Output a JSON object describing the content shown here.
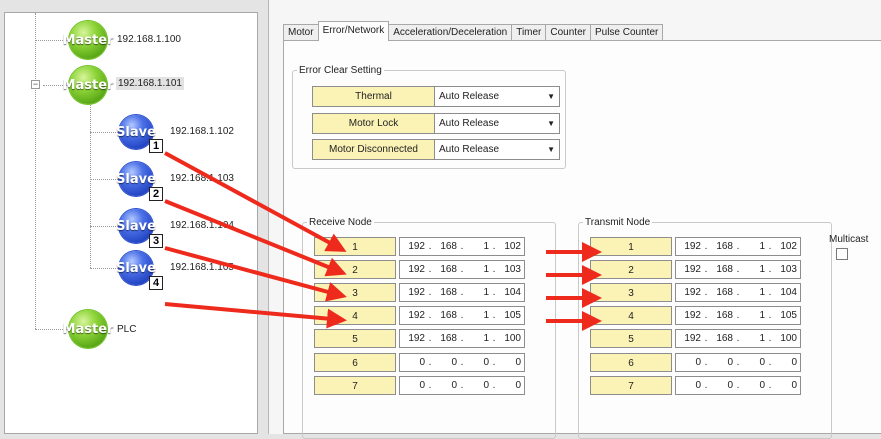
{
  "tree": {
    "masters": [
      {
        "icon_text": "Master",
        "label": "192.168.1.100"
      },
      {
        "icon_text": "Master",
        "label": "192.168.1.101"
      },
      {
        "icon_text": "Master",
        "label": "PLC"
      }
    ],
    "slaves": [
      {
        "icon_text": "Slave",
        "number": "1",
        "label": "192.168.1.102"
      },
      {
        "icon_text": "Slave",
        "number": "2",
        "label": "192.168.1.103"
      },
      {
        "icon_text": "Slave",
        "number": "3",
        "label": "192.168.1.104"
      },
      {
        "icon_text": "Slave",
        "number": "4",
        "label": "192.168.1.105"
      }
    ],
    "expander_symbol": "−"
  },
  "tabs": [
    "Motor",
    "Error/Network",
    "Acceleration/Deceleration",
    "Timer",
    "Counter",
    "Pulse Counter"
  ],
  "active_tab": "Error/Network",
  "error_clear": {
    "legend": "Error Clear Setting",
    "rows": [
      {
        "label": "Thermal",
        "value": "Auto Release"
      },
      {
        "label": "Motor Lock",
        "value": "Auto Release"
      },
      {
        "label": "Motor Disconnected",
        "value": "Auto Release"
      }
    ]
  },
  "receive_node": {
    "legend": "Receive Node",
    "rows": [
      {
        "num": "1",
        "ip": [
          "192",
          "168",
          "1",
          "102"
        ]
      },
      {
        "num": "2",
        "ip": [
          "192",
          "168",
          "1",
          "103"
        ]
      },
      {
        "num": "3",
        "ip": [
          "192",
          "168",
          "1",
          "104"
        ]
      },
      {
        "num": "4",
        "ip": [
          "192",
          "168",
          "1",
          "105"
        ]
      },
      {
        "num": "5",
        "ip": [
          "192",
          "168",
          "1",
          "100"
        ]
      },
      {
        "num": "6",
        "ip": [
          "0",
          "0",
          "0",
          "0"
        ]
      },
      {
        "num": "7",
        "ip": [
          "0",
          "0",
          "0",
          "0"
        ]
      }
    ]
  },
  "transmit_node": {
    "legend": "Transmit Node",
    "multicast_label": "Multicast",
    "multicast_checked": false,
    "rows": [
      {
        "num": "1",
        "ip": [
          "192",
          "168",
          "1",
          "102"
        ]
      },
      {
        "num": "2",
        "ip": [
          "192",
          "168",
          "1",
          "103"
        ]
      },
      {
        "num": "3",
        "ip": [
          "192",
          "168",
          "1",
          "104"
        ]
      },
      {
        "num": "4",
        "ip": [
          "192",
          "168",
          "1",
          "105"
        ]
      },
      {
        "num": "5",
        "ip": [
          "192",
          "168",
          "1",
          "100"
        ]
      },
      {
        "num": "6",
        "ip": [
          "0",
          "0",
          "0",
          "0"
        ]
      },
      {
        "num": "7",
        "ip": [
          "0",
          "0",
          "0",
          "0"
        ]
      }
    ]
  },
  "colors": {
    "arrow": "#ee2a1d",
    "label_fill": "#fbf2b6",
    "master": "#6cc21f",
    "slave": "#2b4fd1"
  },
  "icons": {
    "dropdown": "▼",
    "master_node": "master-node-icon",
    "slave_node": "slave-node-icon"
  }
}
